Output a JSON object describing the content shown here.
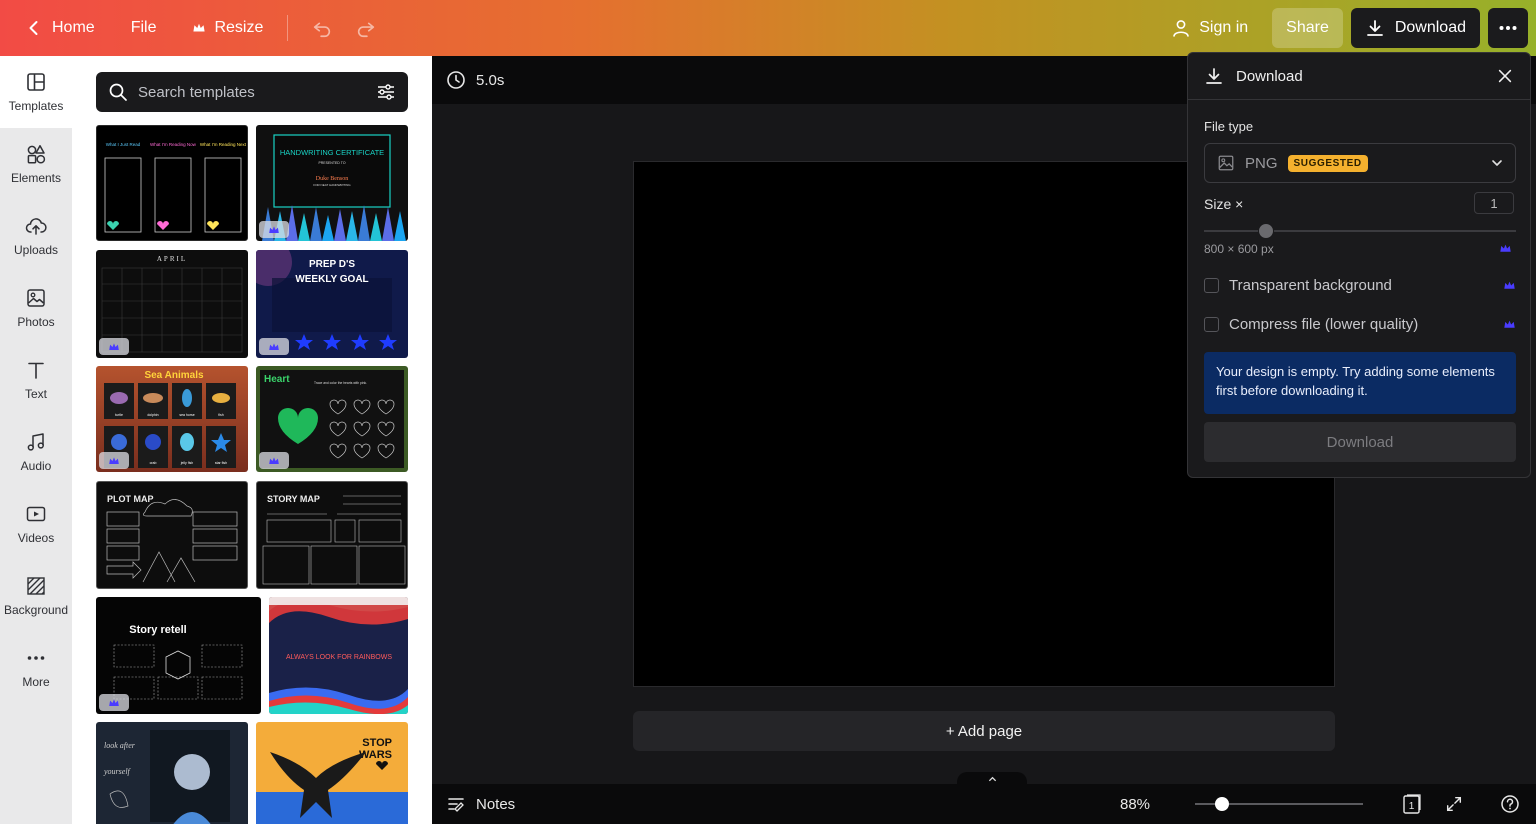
{
  "topbar": {
    "home_label": "Home",
    "file_label": "File",
    "resize_label": "Resize",
    "signin_label": "Sign in",
    "share_label": "Share",
    "download_label": "Download"
  },
  "rail": {
    "items": [
      {
        "label": "Templates"
      },
      {
        "label": "Elements"
      },
      {
        "label": "Uploads"
      },
      {
        "label": "Photos"
      },
      {
        "label": "Text"
      },
      {
        "label": "Audio"
      },
      {
        "label": "Videos"
      },
      {
        "label": "Background"
      },
      {
        "label": "More"
      }
    ]
  },
  "templates": {
    "search_placeholder": "Search templates",
    "cards": [
      {
        "lines": [
          "What I Just Read",
          "What I'm Reading Now",
          "What I'm Reading Next"
        ]
      },
      {
        "lines": [
          "HANDWRITING CERTIFICATE",
          "PRESENTED TO",
          "Duke Benson",
          "FOR NEAT HANDWRITING"
        ]
      },
      {
        "lines": [
          "APRIL"
        ]
      },
      {
        "lines": [
          "PREP D'S",
          "WEEKLY GOAL"
        ]
      },
      {
        "lines": [
          "Sea Animals",
          "turtle",
          "dolphin",
          "sea horse",
          "fish",
          "crab",
          "jelly fish",
          "star fish"
        ]
      },
      {
        "lines": [
          "Heart",
          "Trace and color the hearts with pink."
        ]
      },
      {
        "lines": [
          "PLOT MAP"
        ]
      },
      {
        "lines": [
          "STORY MAP"
        ]
      },
      {
        "lines": [
          "Story retell"
        ]
      },
      {
        "lines": [
          "ALWAYS LOOK FOR RAINBOWS"
        ]
      },
      {
        "lines": [
          "look after",
          "yourself"
        ]
      },
      {
        "lines": [
          "STOP",
          "WARS"
        ]
      }
    ]
  },
  "editor": {
    "duration": "5.0s",
    "add_page_label": "+ Add page",
    "notes_label": "Notes",
    "zoom_label": "88%",
    "zoom_value": 0.16,
    "page_count": "1"
  },
  "download_dialog": {
    "title": "Download",
    "file_type_label": "File type",
    "file_type_value": "PNG",
    "suggested_badge": "SUGGESTED",
    "size_label": "Size ×",
    "size_value": "1",
    "size_slider_value": 0.2,
    "dimensions": "800 × 600 px",
    "transparent_label": "Transparent background",
    "compress_label": "Compress file (lower quality)",
    "empty_message": "Your design is empty. Try adding some elements first before downloading it.",
    "download_button": "Download"
  },
  "colors": {
    "premium_crown": "#4a3cff",
    "badge": "#f5b12e",
    "alert_bg": "#0b2b63"
  }
}
